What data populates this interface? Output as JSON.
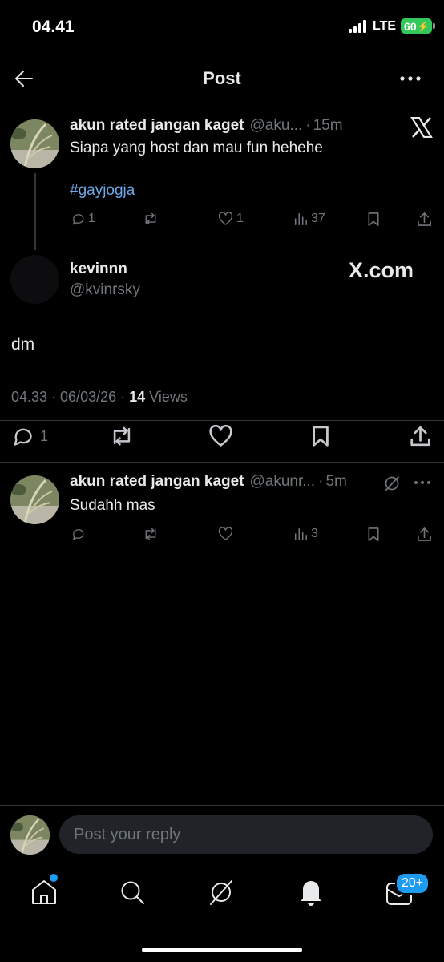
{
  "status_bar": {
    "time": "04.41",
    "network": "LTE",
    "battery": "60"
  },
  "header": {
    "title": "Post"
  },
  "parent_post": {
    "author_name": "akun rated jangan kaget",
    "handle": "@aku...",
    "time": "15m",
    "text": "Siapa yang host dan mau fun hehehe",
    "hashtag": "#gayjogja",
    "replies": "1",
    "retweets": "",
    "likes": "1",
    "views": "37"
  },
  "main_post": {
    "author_name": "kevinnn",
    "handle": "@kvinrsky",
    "watermark": "X.com",
    "text": "dm",
    "timestamp": "04.33 · 06/03/26 · ",
    "views_count": "14",
    "views_label": " Views",
    "replies": "1"
  },
  "reply_post": {
    "author_name": "akun rated jangan kaget",
    "handle": "@akunr...",
    "time": "5m",
    "text": "Sudahh mas",
    "views": "3"
  },
  "composer": {
    "placeholder": "Post your reply"
  },
  "tab_bar": {
    "notifications_badge": "20+"
  },
  "colors": {
    "accent": "#1d9bf0",
    "hashtag": "#6ea8e8",
    "muted": "#71767b",
    "battery": "#34c759"
  }
}
